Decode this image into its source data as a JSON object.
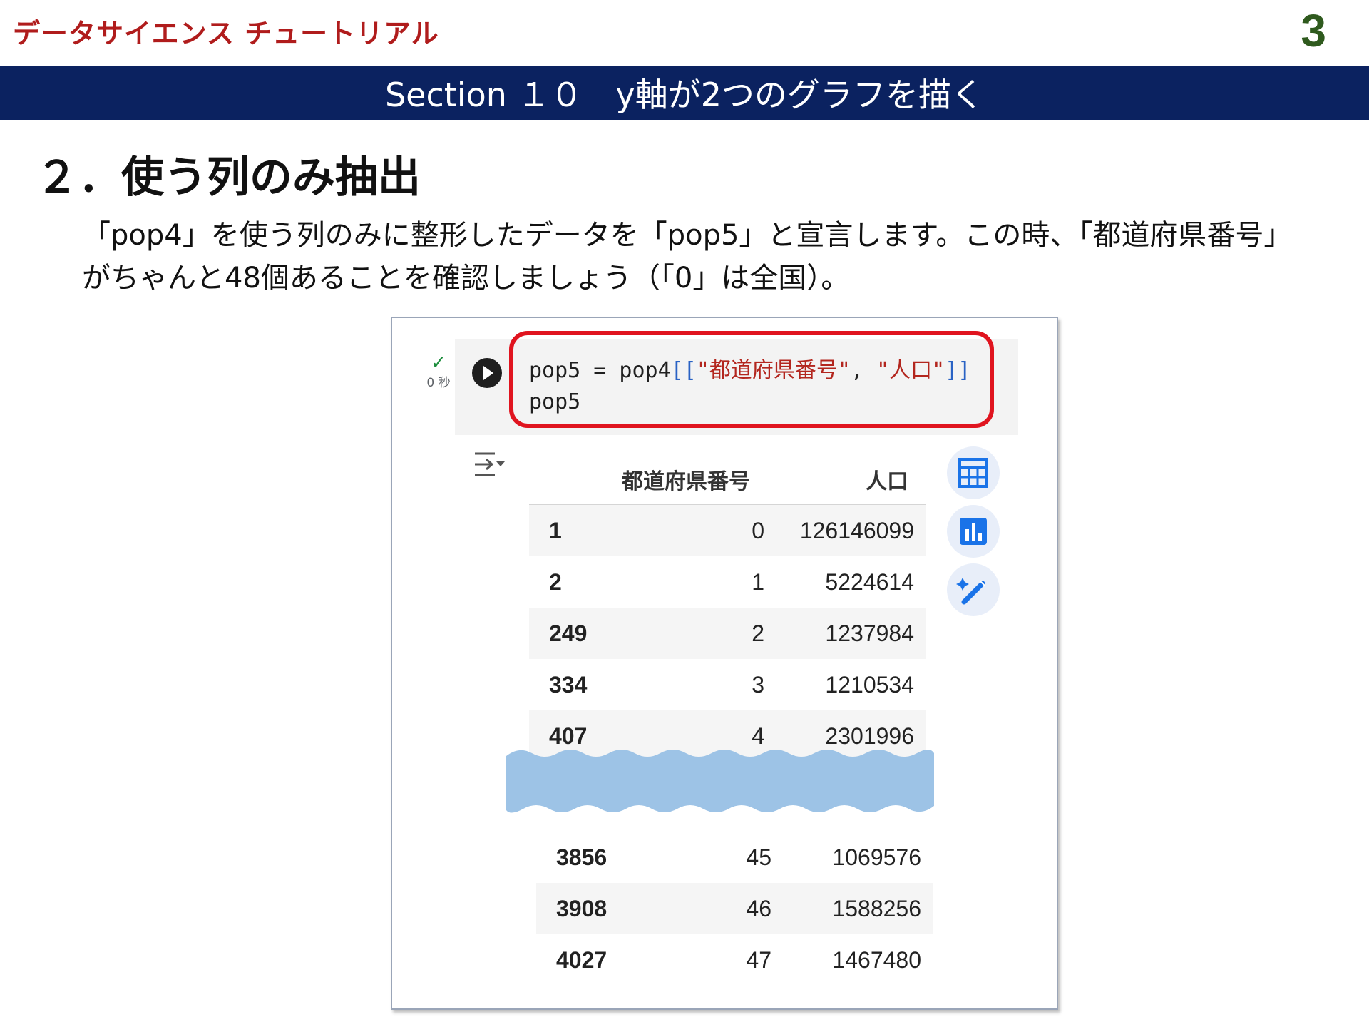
{
  "header": {
    "brand": "データサイエンス チュートリアル",
    "page_number": "3",
    "section_title": "Section １０　y軸が2つのグラフを描く"
  },
  "main": {
    "heading": "２．使う列のみ抽出",
    "description_line1": "「pop4」を使う列のみに整形したデータを「pop5」と宣言します。この時、「都道府県番号」",
    "description_line2": "がちゃんと48個あることを確認しましょう（「0」は全国）。"
  },
  "notebook": {
    "status_time": "0 秒",
    "code_line1_a": "pop5 = pop4",
    "code_line1_b": "[[",
    "code_line1_c": "\"都道府県番号\"",
    "code_line1_d": ", ",
    "code_line1_e": "\"人口\"",
    "code_line1_f": "]]",
    "code_line2": "pop5",
    "table": {
      "columns": [
        "都道府県番号",
        "人口"
      ],
      "rows_top": [
        {
          "index": "1",
          "pref": "0",
          "pop": "126146099"
        },
        {
          "index": "2",
          "pref": "1",
          "pop": "5224614"
        },
        {
          "index": "249",
          "pref": "2",
          "pop": "1237984"
        },
        {
          "index": "334",
          "pref": "3",
          "pop": "1210534"
        },
        {
          "index": "407",
          "pref": "4",
          "pop": "2301996"
        }
      ],
      "rows_bottom": [
        {
          "index": "3856",
          "pref": "45",
          "pop": "1069576"
        },
        {
          "index": "3908",
          "pref": "46",
          "pop": "1588256"
        },
        {
          "index": "4027",
          "pref": "47",
          "pop": "1467480"
        }
      ]
    },
    "side_buttons": [
      "table-icon",
      "chart-icon",
      "magic-edit-icon"
    ],
    "accent_color": "#e0141f",
    "section_bar_color": "#0b2260"
  }
}
